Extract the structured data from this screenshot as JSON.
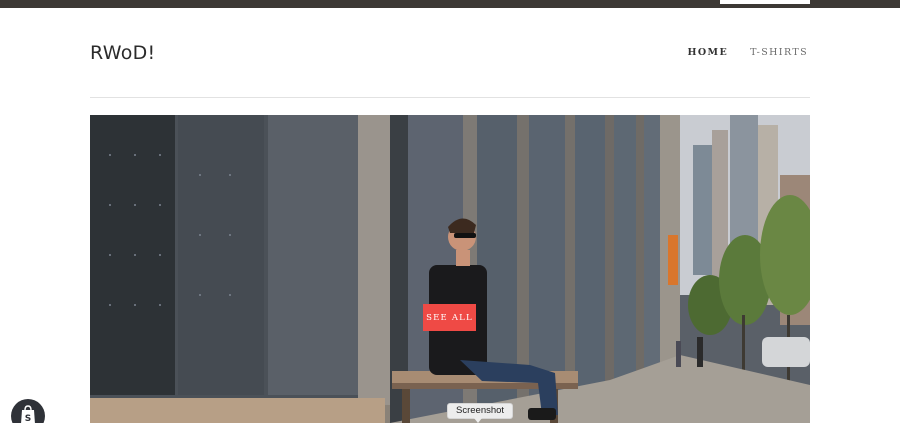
{
  "header": {
    "logo": "RWoD!",
    "nav": [
      {
        "label": "HOME",
        "active": true
      },
      {
        "label": "T-SHIRTS",
        "active": false
      }
    ]
  },
  "hero": {
    "image": "person-sitting-on-bench-city-street",
    "cta_label": "SEE ALL",
    "cta_color": "#ef4a45"
  },
  "tooltip": {
    "text": "Screenshot"
  },
  "badge": {
    "icon": "shopify-bag-icon"
  },
  "colors": {
    "topbar": "#3d3935",
    "accent": "#ef4a45"
  }
}
